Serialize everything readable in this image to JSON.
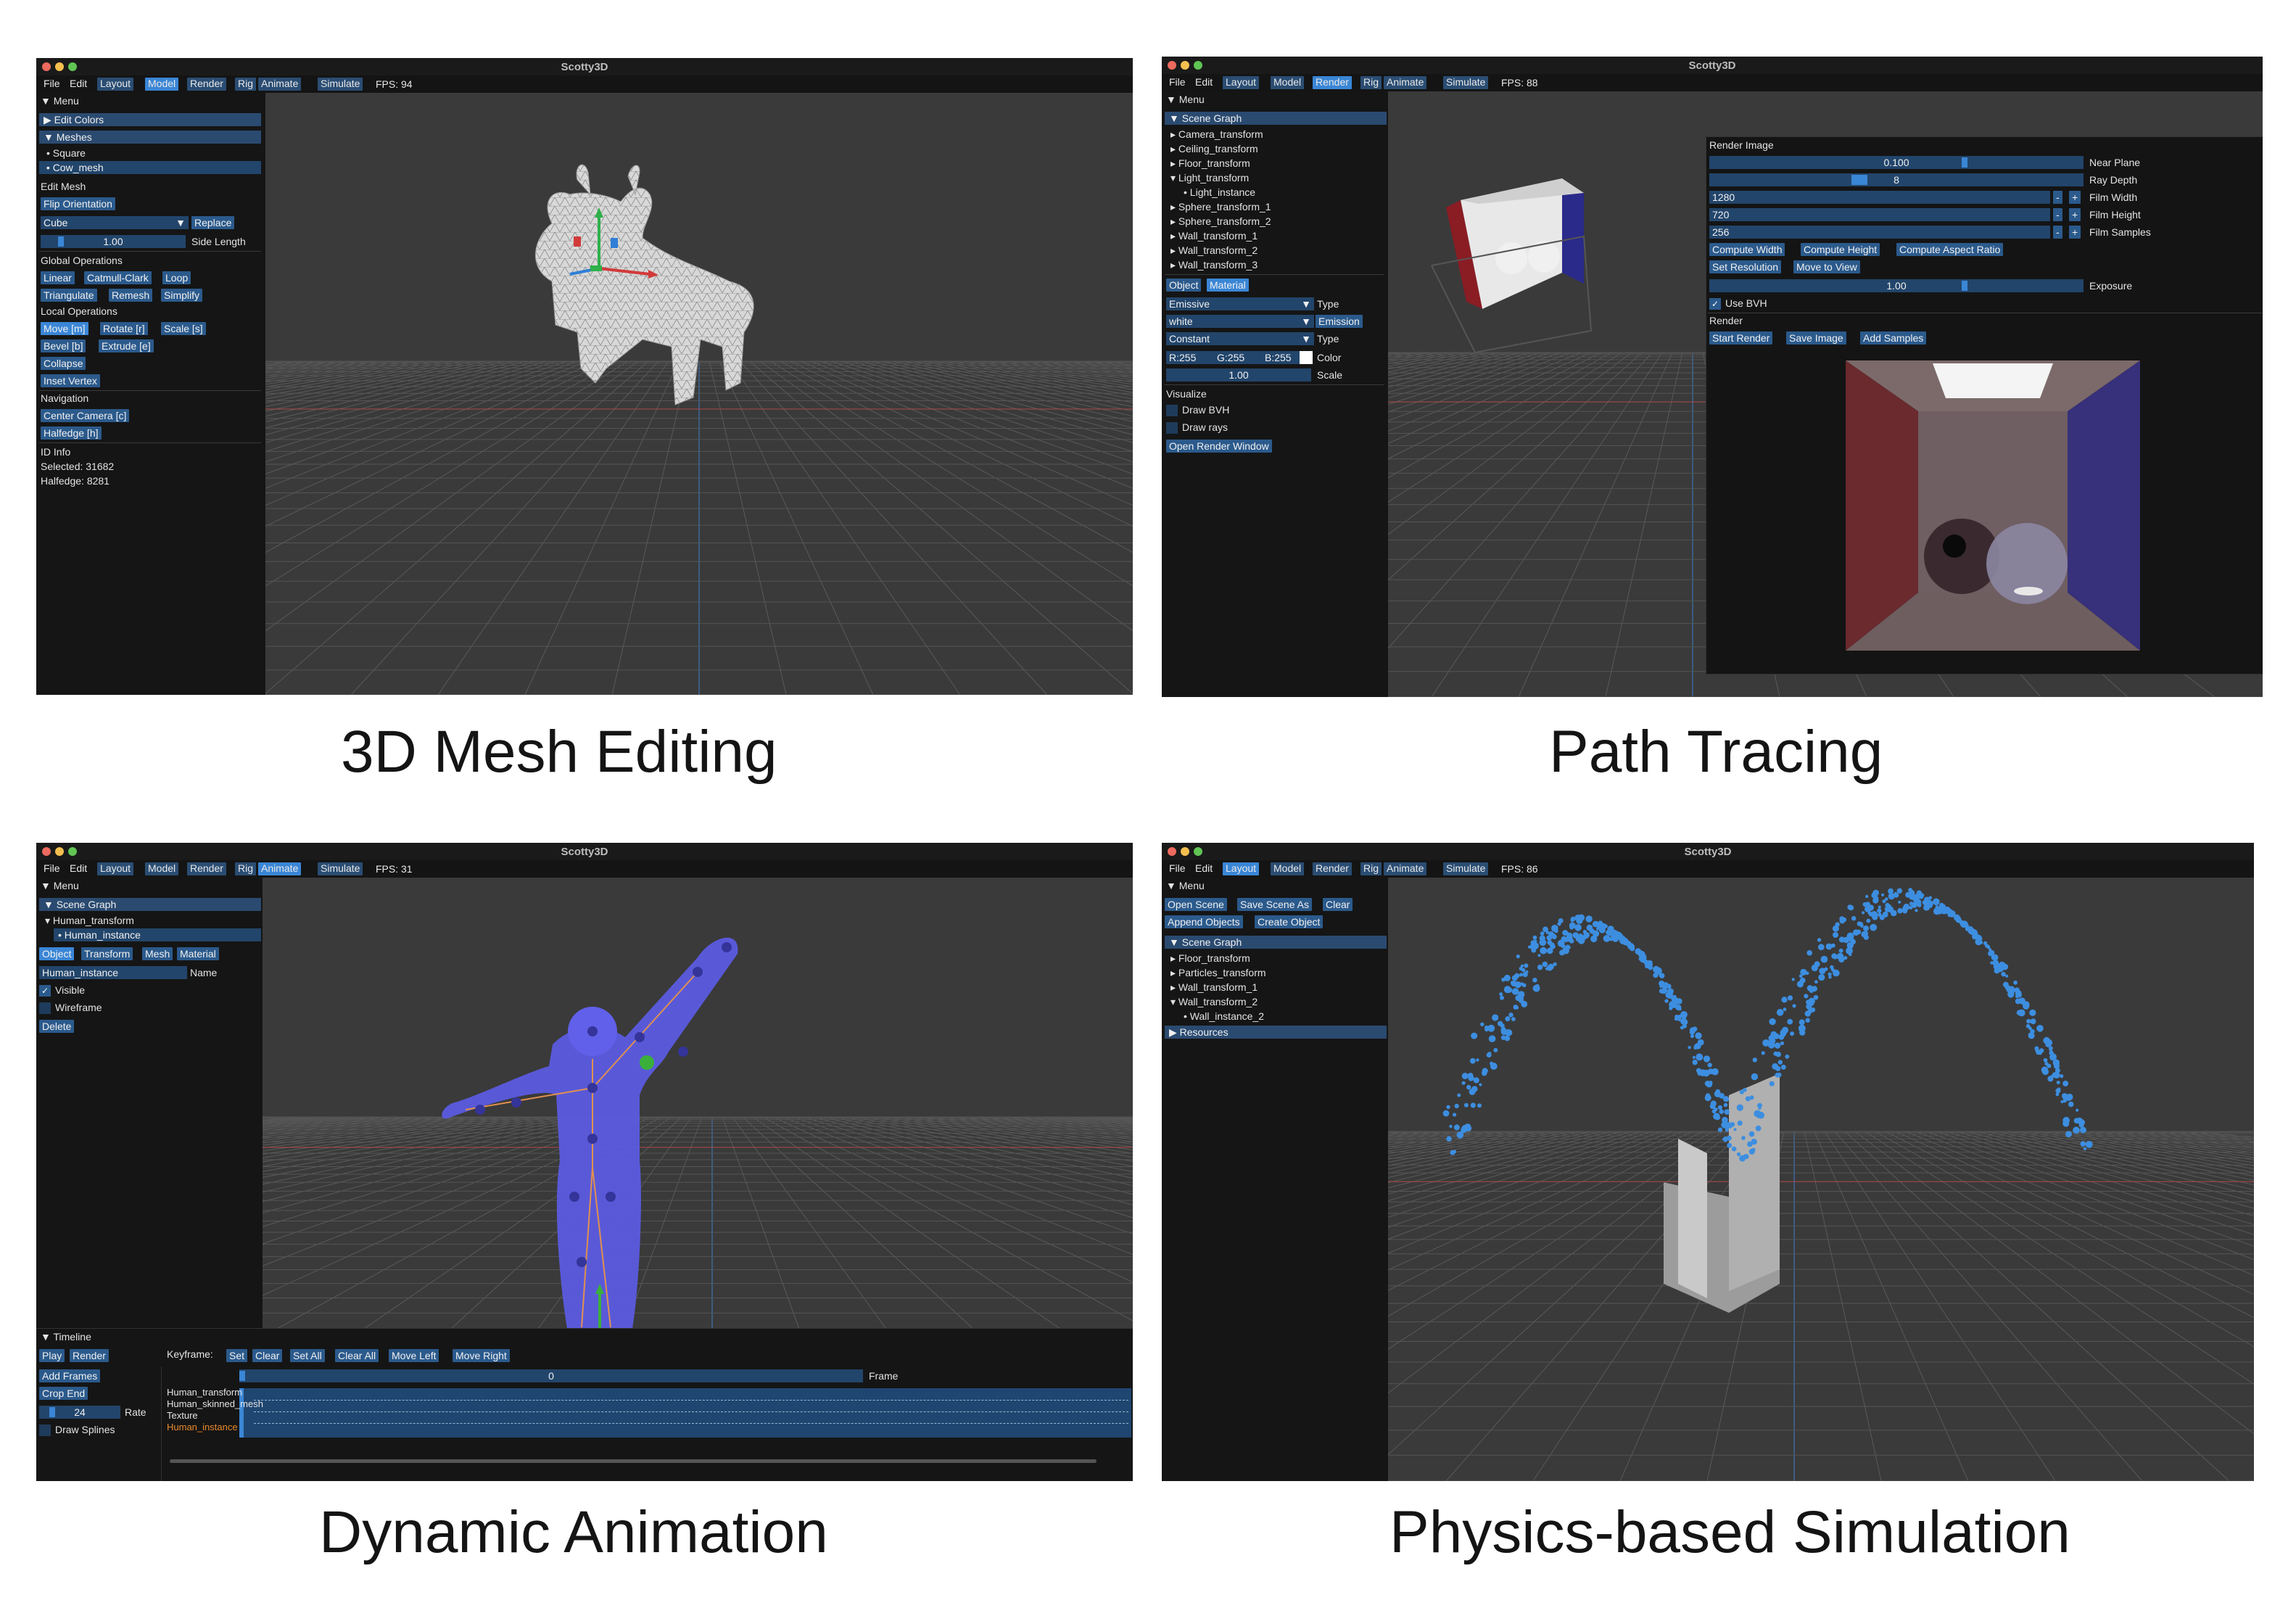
{
  "app_title": "Scotty3D",
  "captions": [
    "3D Mesh Editing",
    "Path Tracing",
    "Dynamic Animation",
    "Physics-based Simulation"
  ],
  "colors": {
    "accent": "#3a86d6",
    "button": "#2b5a8c",
    "header": "#2a4a70",
    "panel": "#151515",
    "viewport": "#3a3a3a",
    "particles": "#3d8ee0"
  },
  "windows": [
    {
      "menu": [
        "File",
        "Edit",
        "Layout",
        "Model",
        "Render",
        "Rig",
        "Animate",
        "Simulate"
      ],
      "active": "Model",
      "fps": "FPS: 94",
      "panel": {
        "menu_label": "Menu",
        "edit_colors": "Edit Colors",
        "meshes": "Meshes",
        "mesh_items": [
          "Square",
          "Cow_mesh"
        ],
        "edit_mesh": "Edit Mesh",
        "flip_orientation": "Flip Orientation",
        "shape_select": "Cube",
        "replace": "Replace",
        "side_value": "1.00",
        "side_label": "Side Length",
        "global_ops": "Global Operations",
        "global_buttons": [
          "Linear",
          "Catmull-Clark",
          "Loop",
          "Triangulate",
          "Remesh",
          "Simplify"
        ],
        "local_ops": "Local Operations",
        "local_buttons": [
          "Move [m]",
          "Rotate [r]",
          "Scale [s]",
          "Bevel [b]",
          "Extrude [e]",
          "Collapse",
          "Inset Vertex"
        ],
        "navigation": "Navigation",
        "nav_buttons": [
          "Center Camera [c]",
          "Halfedge [h]"
        ],
        "id_info": "ID Info",
        "selected": "Selected: 31682",
        "halfedge": "Halfedge: 8281"
      }
    },
    {
      "menu": [
        "File",
        "Edit",
        "Layout",
        "Model",
        "Render",
        "Rig",
        "Animate",
        "Simulate"
      ],
      "active": "Render",
      "fps": "FPS: 88",
      "panel": {
        "menu_label": "Menu",
        "scene_graph": "Scene Graph",
        "tree": [
          "Camera_transform",
          "Ceiling_transform",
          "Floor_transform",
          "Light_transform",
          "Light_instance",
          "Sphere_transform_1",
          "Sphere_transform_2",
          "Wall_transform_1",
          "Wall_transform_2",
          "Wall_transform_3"
        ],
        "tabs": [
          "Object",
          "Material"
        ],
        "emissive": "Emissive",
        "white": "white",
        "emission": "Emission",
        "constant": "Constant",
        "type_label": "Type",
        "r": "R:255",
        "g": "G:255",
        "b": "B:255",
        "color_label": "Color",
        "scale_value": "1.00",
        "scale_label": "Scale",
        "visualize": "Visualize",
        "draw_bvh": "Draw BVH",
        "draw_rays": "Draw rays",
        "open_render": "Open Render Window"
      },
      "render_panel": {
        "title": "Render Image",
        "near_value": "0.100",
        "near_label": "Near Plane",
        "depth_value": "8",
        "depth_label": "Ray Depth",
        "width_value": "1280",
        "width_label": "Film Width",
        "height_value": "720",
        "height_label": "Film Height",
        "samples_value": "256",
        "samples_label": "Film Samples",
        "minus": "-",
        "plus": "+",
        "compute_buttons": [
          "Compute Width",
          "Compute Height",
          "Compute Aspect Ratio"
        ],
        "res_buttons": [
          "Set Resolution",
          "Move to View"
        ],
        "exposure_value": "1.00",
        "exposure_label": "Exposure",
        "use_bvh": "Use BVH",
        "render_label": "Render",
        "render_buttons": [
          "Start Render",
          "Save Image",
          "Add Samples"
        ]
      }
    },
    {
      "menu": [
        "File",
        "Edit",
        "Layout",
        "Model",
        "Render",
        "Rig",
        "Animate",
        "Simulate"
      ],
      "active": "Animate",
      "fps": "FPS: 31",
      "panel": {
        "menu_label": "Menu",
        "scene_graph": "Scene Graph",
        "tree": [
          "Human_transform",
          "Human_instance"
        ],
        "tabs": [
          "Object",
          "Transform",
          "Mesh",
          "Material"
        ],
        "name_value": "Human_instance",
        "name_label": "Name",
        "visible": "Visible",
        "wireframe": "Wireframe",
        "delete": "Delete"
      },
      "timeline": {
        "label": "Timeline",
        "buttons": [
          "Play",
          "Render"
        ],
        "keyframe_label": "Keyframe:",
        "keyframe_buttons": [
          "Set",
          "Clear",
          "Set All",
          "Clear All",
          "Move Left",
          "Move Right"
        ],
        "add_frames": "Add Frames",
        "crop_end": "Crop End",
        "frame_value": "0",
        "frame_label": "Frame",
        "rate_value": "24",
        "rate_label": "Rate",
        "draw_splines": "Draw Splines",
        "tracks": [
          "Human_transform",
          "Human_skinned_mesh",
          "Texture",
          "Human_instance"
        ]
      }
    },
    {
      "menu": [
        "File",
        "Edit",
        "Layout",
        "Model",
        "Render",
        "Rig",
        "Animate",
        "Simulate"
      ],
      "active": "Layout",
      "fps": "FPS: 86",
      "panel": {
        "menu_label": "Menu",
        "scene_buttons": [
          "Open Scene",
          "Save Scene As",
          "Clear"
        ],
        "object_buttons": [
          "Append Objects",
          "Create Object"
        ],
        "scene_graph": "Scene Graph",
        "tree": [
          "Floor_transform",
          "Particles_transform",
          "Wall_transform_1",
          "Wall_transform_2",
          "Wall_instance_2"
        ],
        "resources": "Resources"
      }
    }
  ]
}
